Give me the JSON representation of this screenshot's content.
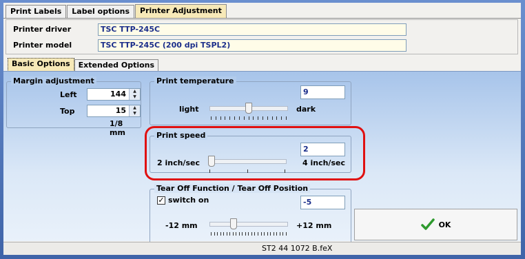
{
  "tabs": [
    {
      "label": "Print Labels"
    },
    {
      "label": "Label options"
    },
    {
      "label": "Printer Adjustment"
    }
  ],
  "printer": {
    "driver_label": "Printer driver",
    "driver_value": "TSC TTP-245C",
    "model_label": "Printer model",
    "model_value": "TSC TTP-245C (200 dpi TSPL2)"
  },
  "subtabs": [
    {
      "label": "Basic Options"
    },
    {
      "label": "Extended Options"
    }
  ],
  "margin": {
    "title": "Margin adjustment",
    "left_label": "Left",
    "left_value": "144",
    "top_label": "Top",
    "top_value": "15",
    "unit": "1/8 mm"
  },
  "temperature": {
    "title": "Print temperature",
    "value": "9",
    "min_label": "light",
    "max_label": "dark",
    "level": 0.5
  },
  "speed": {
    "title": "Print speed",
    "value": "2",
    "min_label": "2 inch/sec",
    "max_label": "4 inch/sec",
    "level": 0.0
  },
  "tearoff": {
    "title": "Tear Off Function / Tear Off Position",
    "switch_label": "switch on",
    "switch_checked": true,
    "value": "-5",
    "min_label": "-12 mm",
    "max_label": "+12 mm",
    "level": 0.29
  },
  "ok_label": "OK",
  "status_text": "ST2 44 1072 B.feX",
  "colors": {
    "accent_active_tab": "#f7e9b8",
    "highlight": "#e01010"
  }
}
